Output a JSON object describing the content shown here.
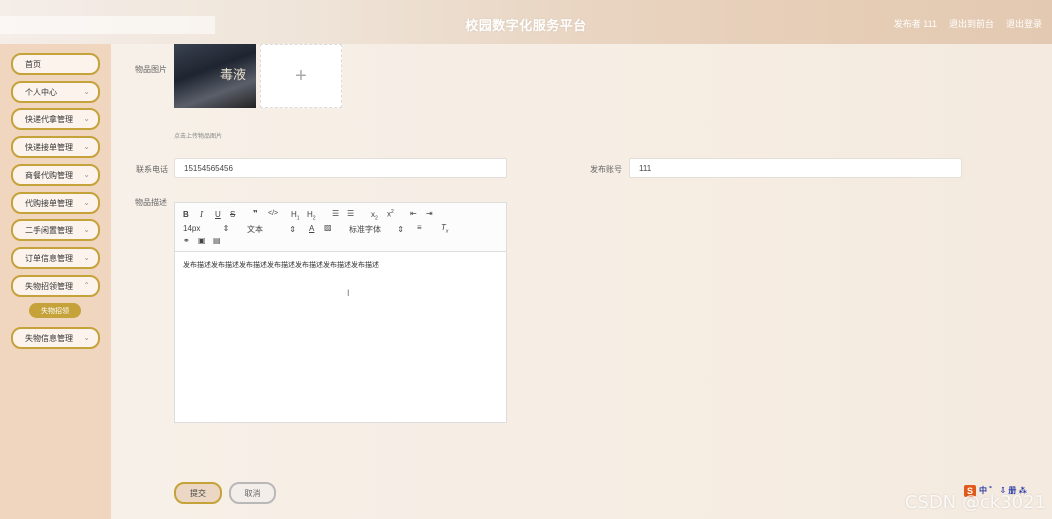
{
  "header": {
    "title": "校园数字化服务平台",
    "user": "发布者 111",
    "exit_back": "退出到前台",
    "logout": "退出登录"
  },
  "sidebar": {
    "items": [
      {
        "label": "首页",
        "has_chevron": false
      },
      {
        "label": "个人中心",
        "has_chevron": true
      },
      {
        "label": "快递代拿管理",
        "has_chevron": true
      },
      {
        "label": "快递接单管理",
        "has_chevron": true
      },
      {
        "label": "商餐代购管理",
        "has_chevron": true
      },
      {
        "label": "代购接单管理",
        "has_chevron": true
      },
      {
        "label": "二手闲置管理",
        "has_chevron": true
      },
      {
        "label": "订单信息管理",
        "has_chevron": true
      },
      {
        "label": "失物招领管理",
        "has_chevron": true
      },
      {
        "label": "失物信息管理",
        "has_chevron": true
      }
    ],
    "sub_item": "失物招领"
  },
  "form": {
    "image_label": "物品图片",
    "image_thumb_text": "毒液",
    "upload_plus": "+",
    "upload_hint": "点击上传物品图片",
    "phone_label": "联系电话",
    "phone_value": "15154565456",
    "account_label": "发布账号",
    "account_value": "111",
    "desc_label": "物品描述",
    "desc_content": "发布描述发布描述发布描述发布描述发布描述发布描述发布描述",
    "submit": "提交",
    "cancel": "取消"
  },
  "editor": {
    "font_size": "14px",
    "paragraph": "文本",
    "font_family": "标准字体"
  },
  "watermark": "CSDN @ck3021",
  "ime": "中 ゛ ⇩ 册 ⁂"
}
